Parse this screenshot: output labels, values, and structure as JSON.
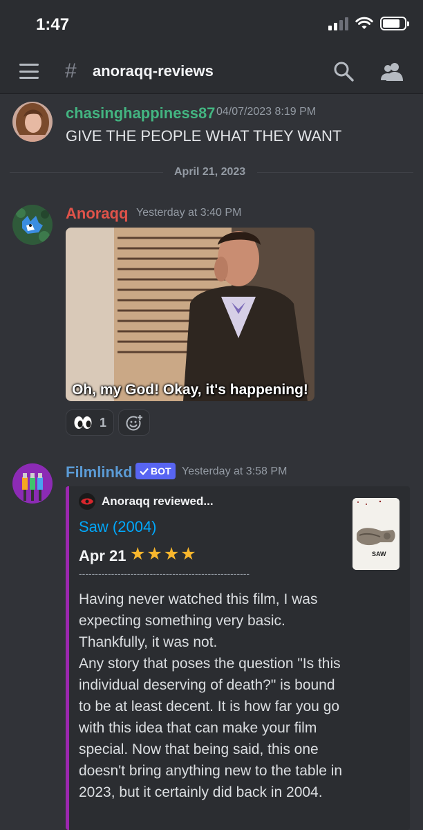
{
  "status_bar": {
    "time": "1:47"
  },
  "header": {
    "channel_name": "anoraqq-reviews"
  },
  "messages": [
    {
      "author": "chasinghappiness87",
      "author_color": "#43b581",
      "timestamp": "04/07/2023 8:19 PM",
      "text": "GIVE THE PEOPLE WHAT THEY WANT"
    },
    {
      "author": "Anoraqq",
      "author_color": "#e0534a",
      "timestamp": "Yesterday at 3:40 PM",
      "gif_caption": "Oh, my God! Okay, it's happening!",
      "reaction": {
        "emoji": "👀",
        "count": "1"
      }
    },
    {
      "author": "Filmlinkd",
      "author_color": "#5b9bd5",
      "badge": "BOT",
      "timestamp": "Yesterday at 3:58 PM",
      "embed": {
        "color": "#9b27af",
        "author": "Anoraqq reviewed...",
        "title": "Saw (2004)",
        "date": "Apr 21",
        "rating_stars": 4,
        "divider": "-----------------------------------------------------",
        "description": "Having never watched this film, I was expecting something very basic. Thankfully, it was not.\nAny story that poses the question \"Is this individual deserving of death?\" is bound to be at least decent. It is how far you go with this idea that can make your film special. Now that being said, this one doesn't bring anything new to the table in 2023, but it certainly did back in 2004.",
        "thumbnail_text": "SAW"
      }
    }
  ],
  "date_divider": "April 21, 2023"
}
